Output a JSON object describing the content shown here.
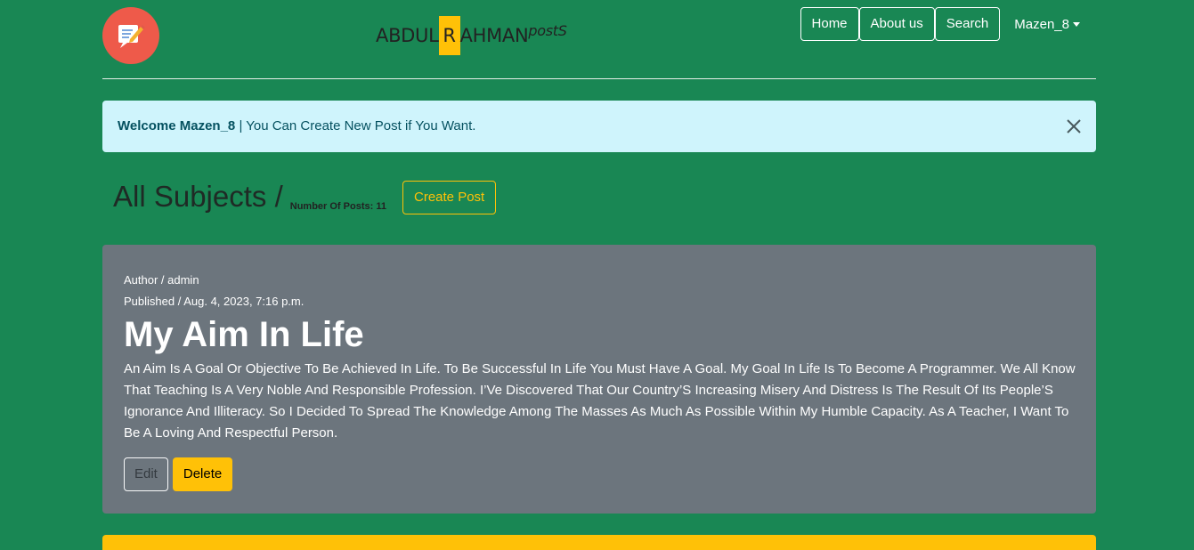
{
  "brand": {
    "part1": "ABDUL",
    "highlight": "R",
    "part2": "AHMAN",
    "suffix": "postS"
  },
  "nav": {
    "items": [
      {
        "label": "Home"
      },
      {
        "label": "About us"
      },
      {
        "label": "Search"
      }
    ],
    "user": "Mazen_8"
  },
  "alert": {
    "bold": "Welcome Mazen_8",
    "text": " | You Can Create New Post if You Want."
  },
  "subjects": {
    "heading": "All Subjects /",
    "count": "Number Of Posts: 11",
    "create_label": "Create Post"
  },
  "post": {
    "author": "Author / admin",
    "published": "Published / Aug. 4, 2023, 7:16 p.m.",
    "title": "My Aim In Life",
    "body": "An Aim Is A Goal Or Objective To Be Achieved In Life. To Be Successful In Life You Must Have A Goal. My Goal In Life Is To Become A Programmer. We All Know That Teaching Is A Very Noble And Responsible Profession. I’Ve Discovered That Our Country’S Increasing Misery And Distress Is The Result Of Its People’S Ignorance And Illiteracy. So I Decided To Spread The Knowledge Among The Masses As Much As Possible Within My Humble Capacity. As A Teacher, I Want To Be A Loving And Respectful Person.",
    "edit_label": "Edit",
    "delete_label": "Delete"
  },
  "colors": {
    "background": "#198754",
    "accent": "#ffc107",
    "card": "#6c757d",
    "alert": "#cff4fc"
  }
}
